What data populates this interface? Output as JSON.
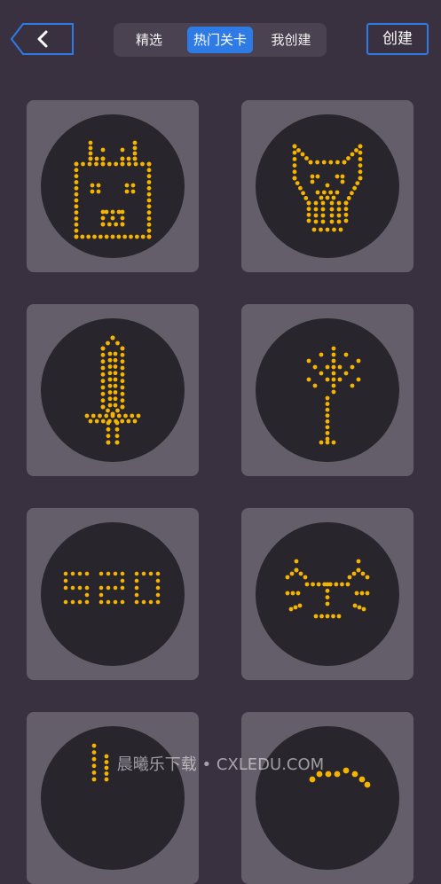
{
  "header": {
    "back_icon": "chevron-left-icon",
    "tabs": [
      {
        "label": "精选",
        "active": false
      },
      {
        "label": "热门关卡",
        "active": true
      },
      {
        "label": "我创建",
        "active": false
      }
    ],
    "create_label": "创建"
  },
  "levels": [
    {
      "pattern": "dog-face"
    },
    {
      "pattern": "cat-face"
    },
    {
      "pattern": "sword"
    },
    {
      "pattern": "tree"
    },
    {
      "pattern": "number-520"
    },
    {
      "pattern": "sleeping-face"
    },
    {
      "pattern": "partial"
    },
    {
      "pattern": "partial"
    }
  ],
  "colors": {
    "dot": "#f5b400",
    "accent": "#2f7be6"
  },
  "watermark": "晨曦乐下载 • CXLEDU.COM"
}
